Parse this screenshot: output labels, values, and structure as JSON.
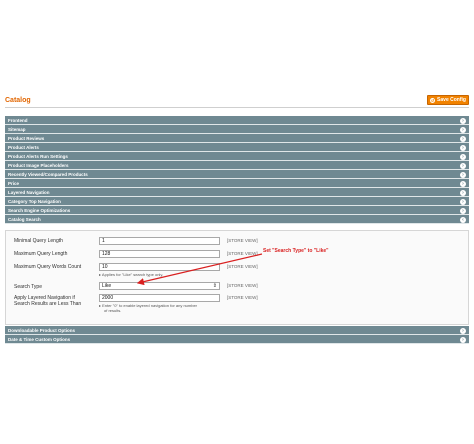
{
  "page": {
    "title": "Catalog",
    "save_label": "Save Config"
  },
  "sections": [
    "Frontend",
    "Sitemap",
    "Product Reviews",
    "Product Alerts",
    "Product Alerts Run Settings",
    "Product Image Placeholders",
    "Recently Viewed/Compared Products",
    "Price",
    "Layered Navigation",
    "Category Top Navigation",
    "Search Engine Optimizations",
    "Catalog Search"
  ],
  "catalog_search": {
    "fields": [
      {
        "label": "Minimal Query Length",
        "value": "1",
        "scope": "[STORE VIEW]"
      },
      {
        "label": "Maximum Query Length",
        "value": "128",
        "scope": "[STORE VIEW]"
      },
      {
        "label": "Maximum Query Words Count",
        "value": "10",
        "scope": "[STORE VIEW]",
        "note": "▸ Applies for \"Like\" search type only."
      },
      {
        "label": "Search Type",
        "value": "Like",
        "scope": "[STORE VIEW]"
      },
      {
        "label1": "Apply Layered Navigation if",
        "label2": "Search Results are Less Than",
        "value": "2000",
        "scope": "[STORE VIEW]",
        "note1": "▸ Enter \"0\" to enable layered navigation for any number",
        "note2": "of results."
      }
    ],
    "annotation": "Set \"Search Type\" to \"Like\""
  },
  "bottom_sections": [
    "Downloadable Product Options",
    "Date & Time Custom Options"
  ],
  "colors": {
    "section_header": "#6f8992",
    "accent": "#f18200",
    "annotation": "#d92020"
  }
}
